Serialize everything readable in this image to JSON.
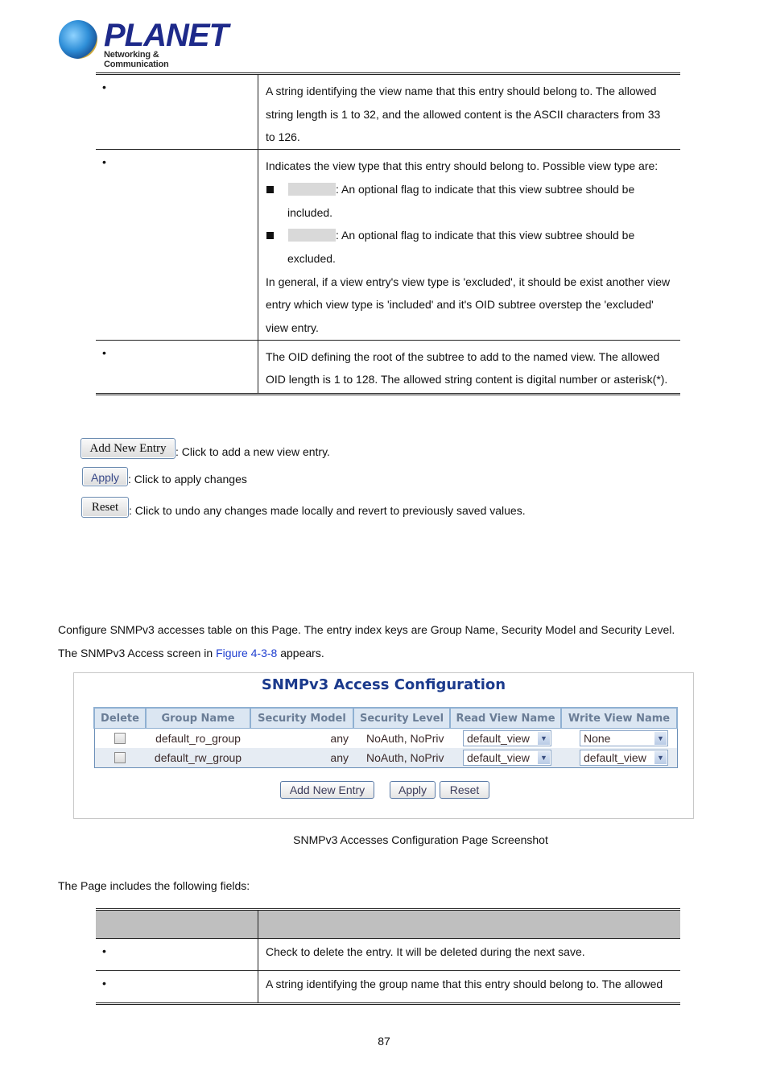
{
  "logo": {
    "brand": "PLANET",
    "tagline": "Networking & Communication",
    "icon": "globe-logo-icon"
  },
  "view_fields_table": {
    "rows": [
      {
        "bullet": "•",
        "lines": [
          "A string identifying the view name that this entry should belong to. The allowed",
          "string length is 1 to 32, and the allowed content is the ASCII characters from 33",
          "to 126."
        ]
      },
      {
        "bullet": "•",
        "intro": "Indicates the view type that this entry should belong to. Possible view type are:",
        "options": [
          {
            "icon": "square-bullet-icon",
            "text": ": An optional flag to indicate that this view subtree should be",
            "continuation": "included."
          },
          {
            "icon": "square-bullet-icon",
            "text": ": An optional flag to indicate that this view subtree should be",
            "continuation": "excluded."
          }
        ],
        "outro": [
          "In general, if a view entry's view type is 'excluded', it should be exist another view",
          "entry which view type is 'included' and it's OID subtree overstep the 'excluded'",
          "view entry."
        ]
      },
      {
        "bullet": "•",
        "lines": [
          "The OID defining the root of the subtree to add to the named view. The allowed",
          "OID length is 1 to 128. The allowed string content is digital number or asterisk(*)."
        ]
      }
    ]
  },
  "button_legend": [
    {
      "label": "Add New Entry",
      "description": ": Click to add a new view entry."
    },
    {
      "label": "Apply",
      "description": ": Click to apply changes"
    },
    {
      "label": "Reset",
      "description": ": Click to undo any changes made locally and revert to previously saved values."
    }
  ],
  "intro": {
    "line1": "Configure SNMPv3 accesses table on this Page. The entry index keys are Group Name, Security Model and Security Level.",
    "line2_prefix": "The SNMPv3 Access screen in ",
    "line2_link": "Figure 4-3-8",
    "line2_suffix": " appears."
  },
  "screenshot": {
    "title": "SNMPv3 Access Configuration",
    "columns": [
      "Delete",
      "Group Name",
      "Security Model",
      "Security Level",
      "Read View Name",
      "Write View Name"
    ],
    "rows": [
      {
        "delete": false,
        "group_name": "default_ro_group",
        "security_model": "any",
        "security_level": "NoAuth, NoPriv",
        "read_view": "default_view",
        "write_view": "None"
      },
      {
        "delete": false,
        "group_name": "default_rw_group",
        "security_model": "any",
        "security_level": "NoAuth, NoPriv",
        "read_view": "default_view",
        "write_view": "default_view"
      }
    ],
    "buttons": {
      "add": "Add New Entry",
      "apply": "Apply",
      "reset": "Reset"
    },
    "colors": {
      "title": "#1b3a8c",
      "header_bg": "#dbe6f2",
      "alt_row_bg": "#e6ecf3"
    }
  },
  "caption": "SNMPv3 Accesses Configuration Page Screenshot",
  "fields_intro": "The Page includes the following fields:",
  "access_fields_table": {
    "rows": [
      {
        "bullet": "•",
        "text": "Check to delete the entry. It will be deleted during the next save."
      },
      {
        "bullet": "•",
        "text": "A string identifying the group name that this entry should belong to. The allowed"
      }
    ]
  },
  "page_number": "87"
}
